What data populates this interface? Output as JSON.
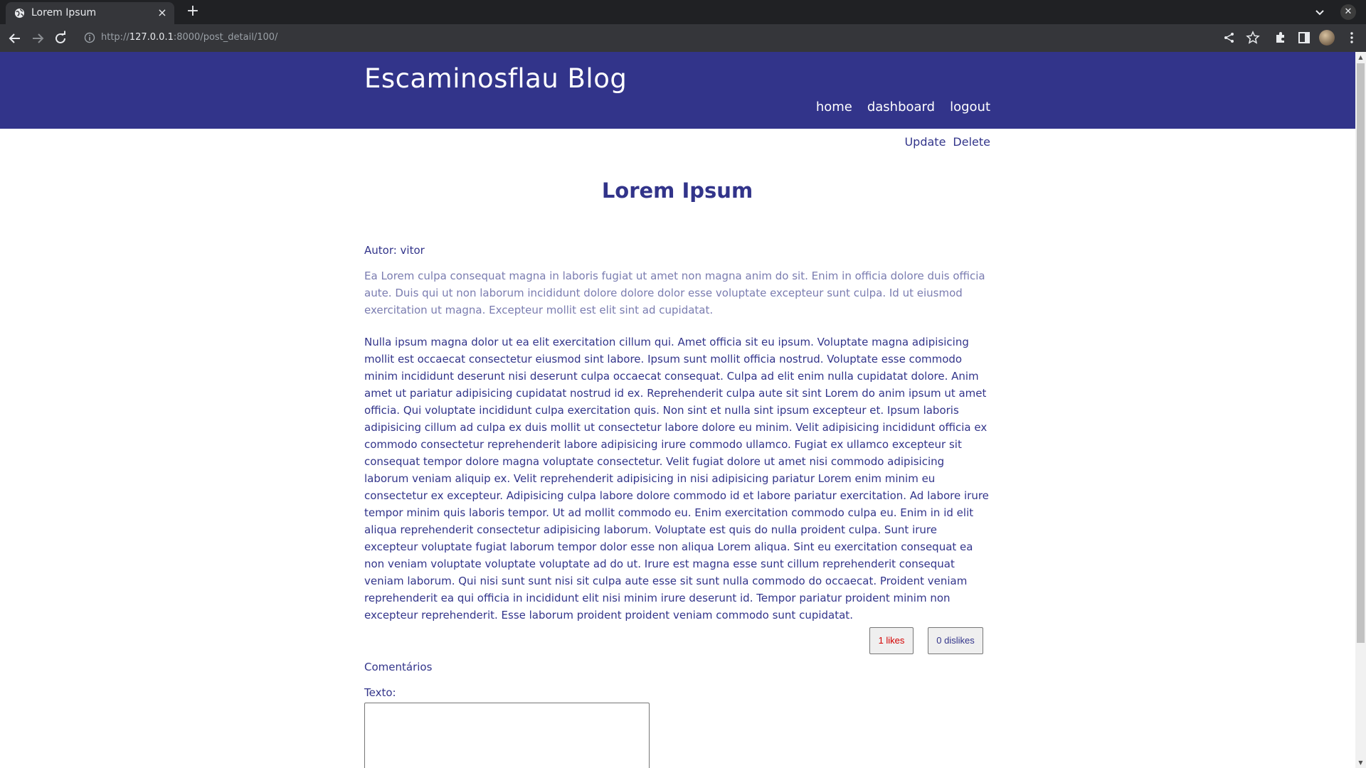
{
  "browser": {
    "tab_title": "Lorem Ipsum",
    "tab_close": "×",
    "new_tab": "+",
    "url_scheme": "http://",
    "url_host": "127.0.0.1",
    "url_rest": ":8000/post_detail/100/",
    "window_close": "✕",
    "icons": [
      "globe-icon",
      "back-icon",
      "forward-icon",
      "reload-icon",
      "info-icon",
      "share-icon",
      "star-icon",
      "extensions-icon",
      "side-panel-icon",
      "profile-avatar",
      "menu-icon",
      "tab-list-icon"
    ]
  },
  "site": {
    "title": "Escaminosflau Blog",
    "nav": [
      "home",
      "dashboard",
      "logout"
    ],
    "header_color": "#32348a"
  },
  "post": {
    "actions": [
      "Update",
      "Delete"
    ],
    "title": "Lorem Ipsum",
    "author": "Autor: vitor",
    "excerpt": "Ea Lorem culpa consequat magna in laboris fugiat ut amet non magna anim do sit. Enim in officia dolore duis officia aute. Duis qui ut non laborum incididunt dolore dolore dolor esse voluptate excepteur sunt culpa. Id ut eiusmod exercitation ut magna. Excepteur mollit est elit sint ad cupidatat.",
    "content": "Nulla ipsum magna dolor ut ea elit exercitation cillum qui. Amet officia sit eu ipsum. Voluptate magna adipisicing mollit est occaecat consectetur eiusmod sint labore. Ipsum sunt mollit officia nostrud. Voluptate esse commodo minim incididunt deserunt nisi deserunt culpa occaecat consequat. Culpa ad elit enim nulla cupidatat dolore. Anim amet ut pariatur adipisicing cupidatat nostrud id ex. Reprehenderit culpa aute sit sint Lorem do anim ipsum ut amet officia. Qui voluptate incididunt culpa exercitation quis. Non sint et nulla sint ipsum excepteur et. Ipsum laboris adipisicing cillum ad culpa ex duis mollit ut consectetur labore dolore eu minim. Velit adipisicing incididunt officia ex commodo consectetur reprehenderit labore adipisicing irure commodo ullamco. Fugiat ex ullamco excepteur sit consequat tempor dolore magna voluptate consectetur. Velit fugiat dolore ut amet nisi commodo adipisicing laborum veniam aliquip ex. Velit reprehenderit adipisicing in nisi adipisicing pariatur Lorem enim minim eu consectetur ex excepteur. Adipisicing culpa labore dolore commodo id et labore pariatur exercitation. Ad labore irure tempor minim quis laboris tempor. Ut ad mollit commodo eu. Enim exercitation commodo culpa eu. Enim in id elit aliqua reprehenderit consectetur adipisicing laborum. Voluptate est quis do nulla proident culpa. Sunt irure excepteur voluptate fugiat laborum tempor dolor esse non aliqua Lorem aliqua. Sint eu exercitation consequat ea non veniam voluptate voluptate voluptate ad do ut. Irure est magna esse sunt cillum reprehenderit consequat veniam laborum. Qui nisi sunt sunt nisi sit culpa aute esse sit sunt nulla commodo do occaecat. Proident veniam reprehenderit ea qui officia in incididunt elit nisi minim irure deserunt id. Tempor pariatur proident minim non excepteur reprehenderit. Esse laborum proident proident veniam commodo sunt cupidatat.",
    "likes_label": "1 likes",
    "dislikes_label": "0 dislikes",
    "like_color": "#d40000"
  },
  "comments": {
    "title": "Comentários",
    "text_label": "Texto:",
    "text_value": ""
  }
}
